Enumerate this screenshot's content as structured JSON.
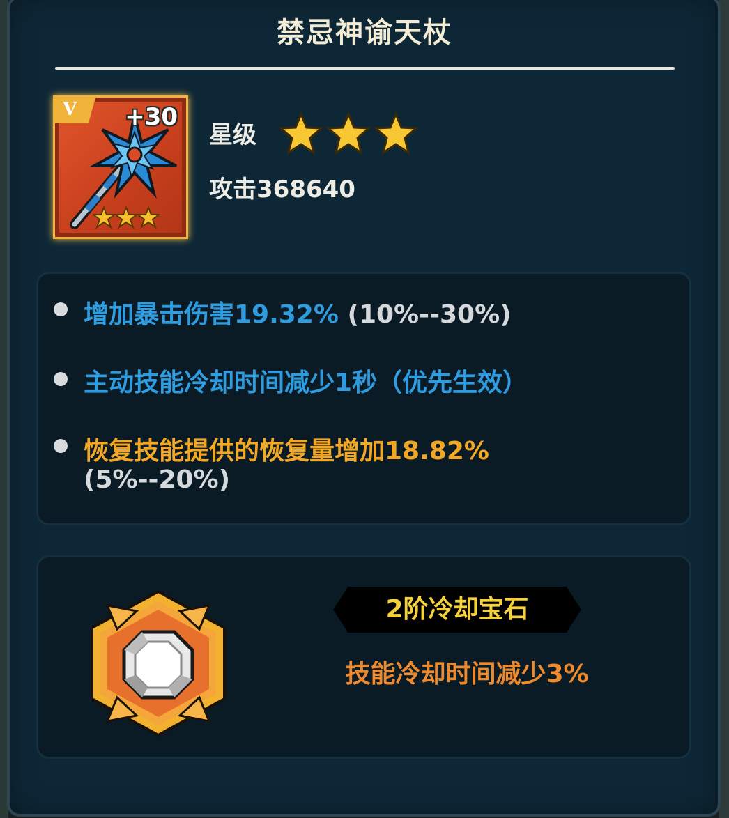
{
  "item": {
    "name": "禁忌神谕天杖",
    "badge": "V",
    "enhance_level": "+30",
    "star_label": "星级",
    "stars": 3,
    "attack_label": "攻击368640"
  },
  "stats": [
    {
      "bullet_color": "#d8dadc",
      "main": "增加暴击伤害19.32%",
      "main_color": "#2f9ce0",
      "range": "(10%--30%)"
    },
    {
      "bullet_color": "#d8dadc",
      "main": "主动技能冷却时间减少1秒（优先生效）",
      "main_color": "#2f9ce0",
      "range": ""
    },
    {
      "bullet_color": "#d8dadc",
      "main": "恢复技能提供的恢复量增加18.82%",
      "main_color": "#f2a725",
      "range": "(5%--20%)"
    }
  ],
  "gem": {
    "name": "2阶冷却宝石",
    "description": "技能冷却时间减少3%",
    "icon": "white-diamond-gem-icon"
  },
  "colors": {
    "panel_bg": "#0e2736",
    "accent_gold": "#f0b43a",
    "stat_blue": "#2f9ce0",
    "stat_gold": "#f2a725",
    "gem_name": "#f6d23a",
    "gem_desc": "#ee8a2e"
  }
}
